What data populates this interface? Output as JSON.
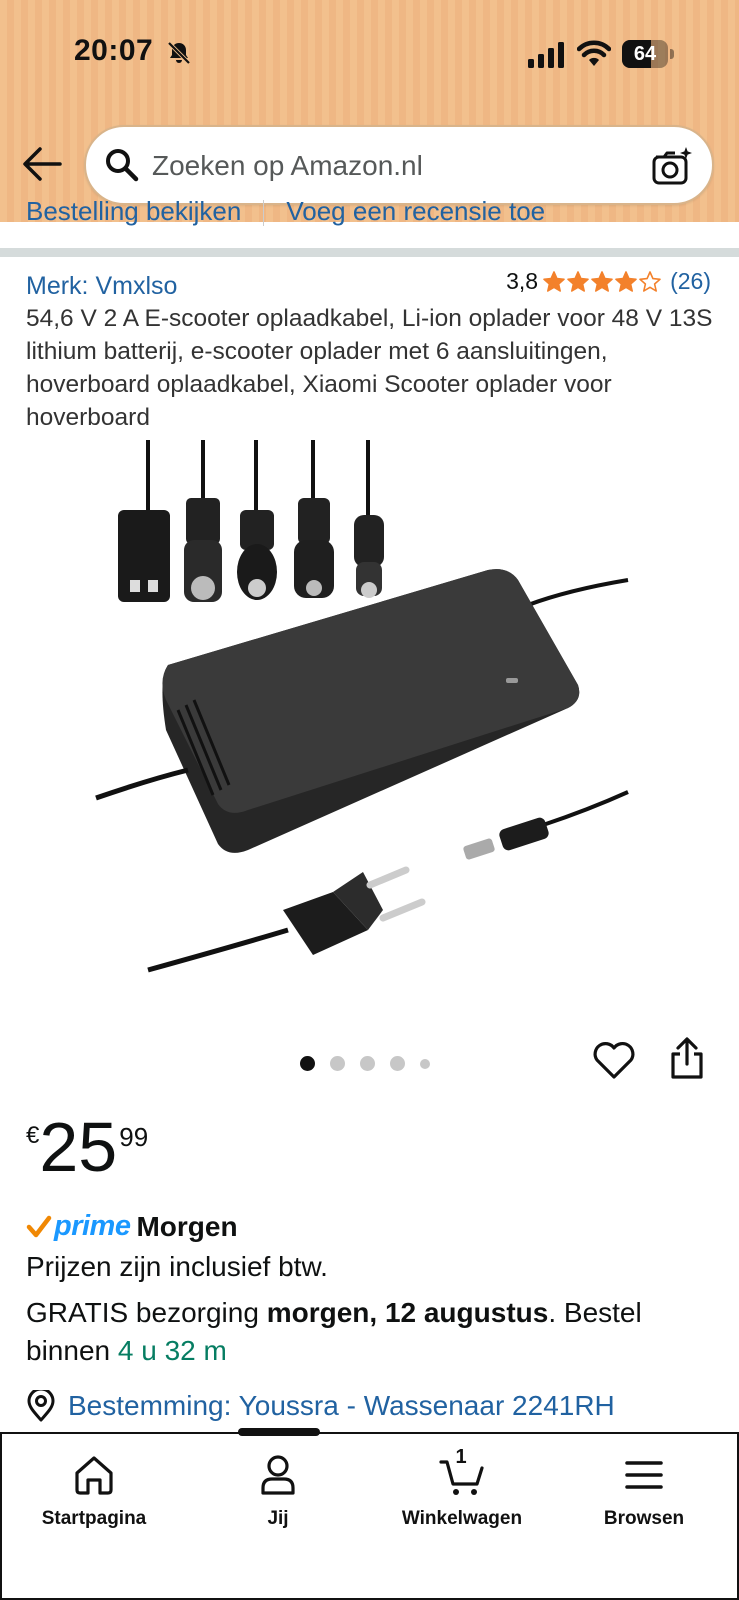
{
  "status_bar": {
    "time": "20:07",
    "battery_percent": "64",
    "battery_level": 0.64,
    "icons": [
      "bell-off-icon",
      "signal-icon",
      "wifi-icon",
      "battery-icon"
    ]
  },
  "header": {
    "search_placeholder": "Zoeken op Amazon.nl",
    "icons": [
      "back-arrow-icon",
      "search-icon",
      "camera-icon"
    ]
  },
  "cut_links": {
    "left": "Bestelling bekijken",
    "right": "Voeg een recensie toe"
  },
  "product": {
    "brand": "Merk: Vmxlso",
    "rating_value": "3,8",
    "rating_stars": 3.8,
    "rating_count": "(26)",
    "title": "54,6 V 2 A E-scooter oplaadkabel, Li-ion oplader voor 48 V 13S lithium batterij, e-scooter oplader met 6 aansluitingen, hoverboard oplaadkabel, Xiaomi Scooter oplader voor hoverboard",
    "image_count": 5,
    "active_image": 0,
    "accent_color": "#2162a1",
    "star_color": "#f3812b"
  },
  "price": {
    "symbol": "€",
    "whole": "25",
    "fraction": "99"
  },
  "delivery": {
    "prime_label": "prime",
    "prime_day": "Morgen",
    "vat_note": "Prijzen zijn inclusief btw.",
    "free_prefix": "GRATIS bezorging ",
    "date": "morgen, 12 augustus",
    "order_prefix": ". Bestel binnen ",
    "countdown": "4 u 32 m",
    "countdown_color": "#067d62",
    "prime_color": "#1a98ff"
  },
  "location": {
    "text": "Bestemming: Youssra - Wassenaar 2241RH"
  },
  "bottom_nav": {
    "items": [
      {
        "label": "Startpagina",
        "icon": "home-icon"
      },
      {
        "label": "Jij",
        "icon": "user-icon"
      },
      {
        "label": "Winkelwagen",
        "icon": "cart-icon"
      },
      {
        "label": "Browsen",
        "icon": "menu-icon"
      }
    ],
    "cart_count": "1"
  }
}
